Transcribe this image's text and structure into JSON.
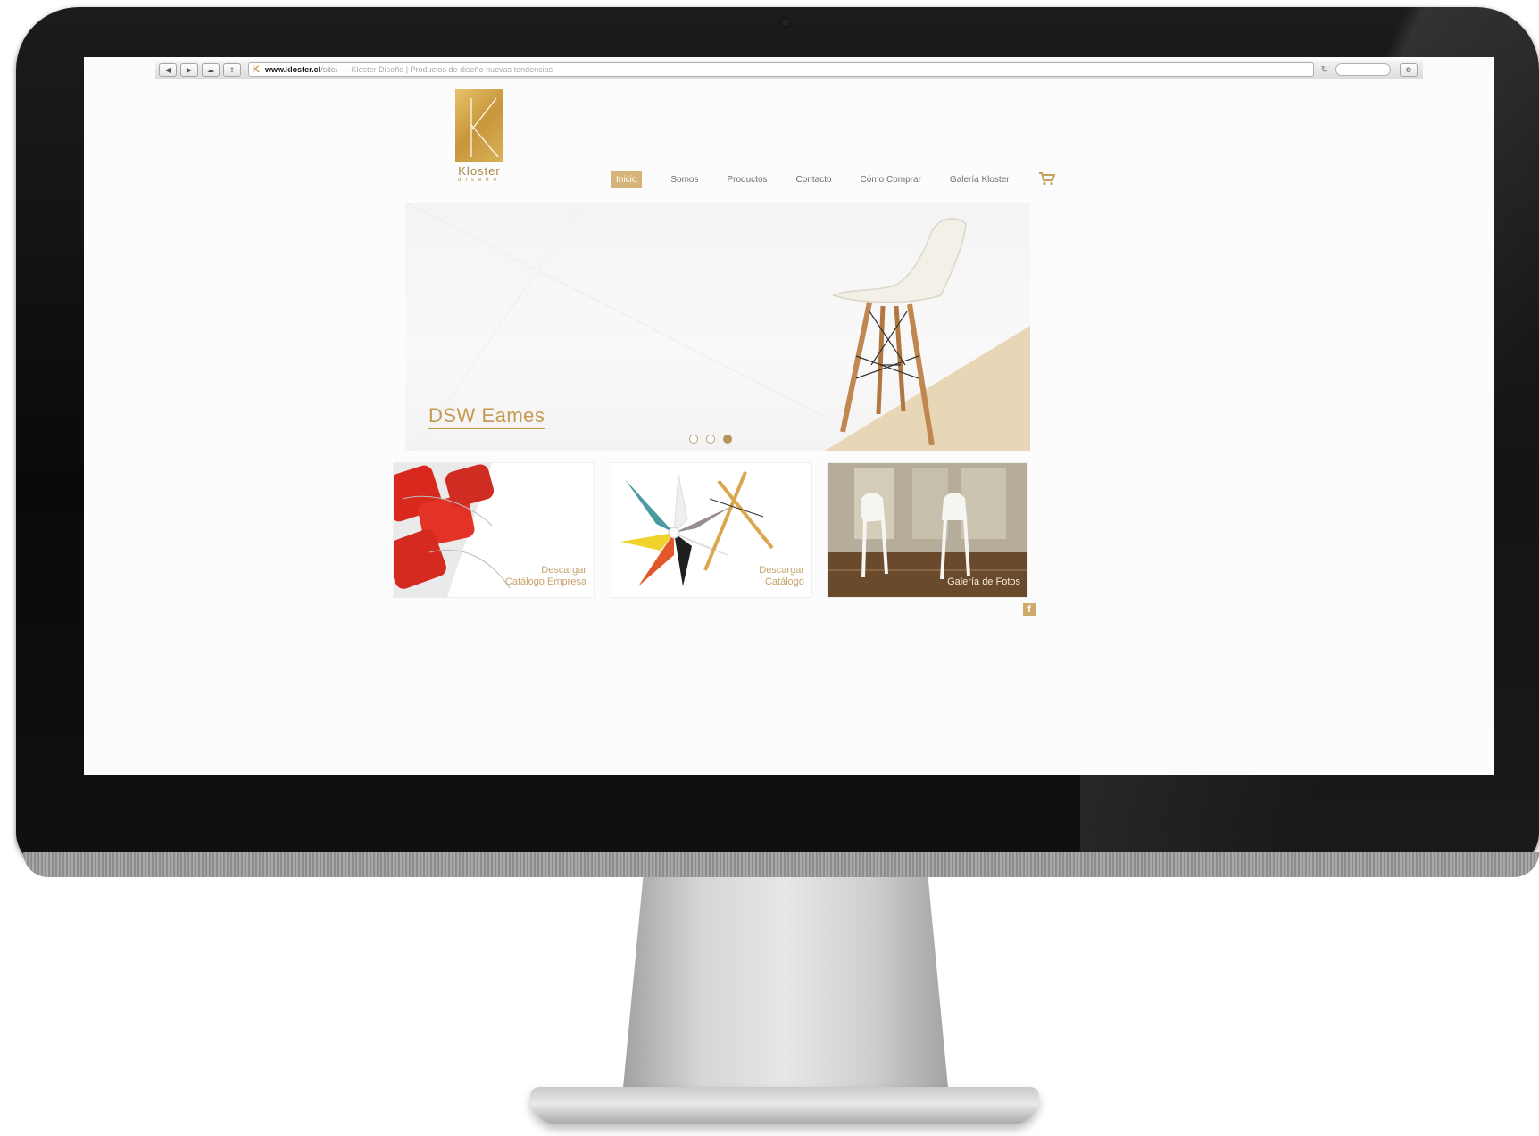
{
  "browser": {
    "url_domain": "www.kloster.cl",
    "url_path": "/site/",
    "page_title": "— Kloster Diseño | Productos de diseño nuevas tendencias",
    "back_icon": "back-icon",
    "forward_icon": "forward-icon"
  },
  "site": {
    "logo_name": "Kloster",
    "logo_sub": "diseño",
    "nav": [
      {
        "label": "Inicio",
        "active": true
      },
      {
        "label": "Somos"
      },
      {
        "label": "Productos"
      },
      {
        "label": "Contacto"
      },
      {
        "label": "Cómo Comprar"
      },
      {
        "label": "Galería Kloster"
      }
    ],
    "cart_icon": "cart-icon",
    "hero": {
      "caption": "DSW Eames",
      "slides": 3,
      "active_slide": 3
    },
    "tiles": [
      {
        "line1": "Descargar",
        "line2": "Catálogo Empresa"
      },
      {
        "line1": "Descargar",
        "line2": "Catálogo"
      },
      {
        "line1": "",
        "line2": "Galería de Fotos"
      }
    ],
    "facebook_icon_label": "f"
  },
  "colors": {
    "accent": "#c59a50",
    "nav_active_bg": "#d7b57a",
    "bezel": "#0f0f0f",
    "screen_bg": "#fcfcfc"
  }
}
